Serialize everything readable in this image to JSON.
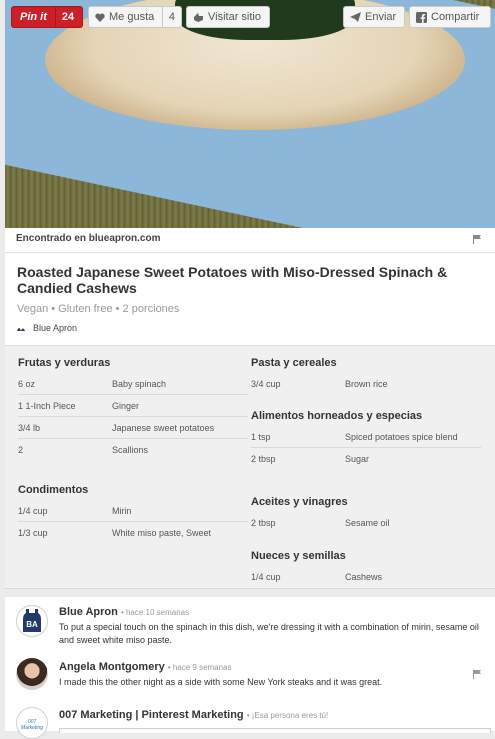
{
  "toolbar": {
    "pin_label": "Pin it",
    "pin_count": "24",
    "like_label": "Me gusta",
    "like_count": "4",
    "visit_label": "Visitar sitio",
    "send_label": "Enviar",
    "share_label": "Compartir"
  },
  "source": {
    "text": "Encontrado en blueapron.com"
  },
  "recipe": {
    "title": "Roasted Japanese Sweet Potatoes with Miso-Dressed Spinach & Candied Cashews",
    "meta": "Vegan • Gluten free • 2 porciones",
    "author": "Blue Apron"
  },
  "ingredients": {
    "left": [
      {
        "title": "Frutas y verduras",
        "items": [
          {
            "qty": "6 oz",
            "name": "Baby spinach"
          },
          {
            "qty": "1 1-Inch Piece",
            "name": "Ginger"
          },
          {
            "qty": "3/4 lb",
            "name": "Japanese sweet potatoes"
          },
          {
            "qty": "2",
            "name": "Scallions"
          }
        ]
      },
      {
        "title": "Condimentos",
        "items": [
          {
            "qty": "1/4 cup",
            "name": "Mirin"
          },
          {
            "qty": "1/3 cup",
            "name": "White miso paste, Sweet"
          }
        ]
      }
    ],
    "right": [
      {
        "title": "Pasta y cereales",
        "items": [
          {
            "qty": "3/4 cup",
            "name": "Brown rice"
          }
        ]
      },
      {
        "title": "Alimentos horneados y especias",
        "items": [
          {
            "qty": "1 tsp",
            "name": "Spiced potatoes spice blend"
          },
          {
            "qty": "2 tbsp",
            "name": "Sugar"
          }
        ]
      },
      {
        "title": "Aceites y vinagres",
        "items": [
          {
            "qty": "2 tbsp",
            "name": "Sesame oil"
          }
        ]
      },
      {
        "title": "Nueces y semillas",
        "items": [
          {
            "qty": "1/4 cup",
            "name": "Cashews"
          }
        ]
      }
    ]
  },
  "comments": [
    {
      "name": "Blue Apron",
      "time": "• hace 10 semanas",
      "text": "To put a special touch on the spinach in this dish, we're dressing it with a combination of mirin, sesame oil and sweet white miso paste.",
      "avatar_text": "BA"
    },
    {
      "name": "Angela Montgomery",
      "time": "• hace 9 semanas",
      "text": "I made this the other night as a side with some New York steaks and it was great."
    },
    {
      "name": "007 Marketing | Pinterest Marketing",
      "time": "• ¡Esa persona eres tú!",
      "avatar_text": "007 Marketing"
    }
  ],
  "colors": {
    "pin_red": "#cb2027",
    "page_bg": "#ebebeb",
    "avatar_navy": "#1f3a6b"
  }
}
